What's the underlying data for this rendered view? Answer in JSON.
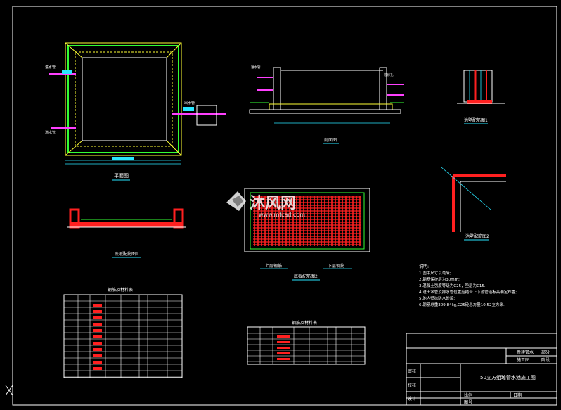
{
  "watermark": {
    "brand": "沐风网",
    "url": "www.mfcad.com"
  },
  "views": {
    "plan": "平面图",
    "section": "剖面图",
    "bottom_rebar_1": "底板配筋图1",
    "bottom_rebar_2": "底板配筋图2",
    "top_rebar": "上层钢筋",
    "bottom_rebar": "下层钢筋",
    "wall_rebar_1": "池壁配筋图1",
    "wall_rebar_2": "池壁配筋图2"
  },
  "pipes": {
    "inlet": "进水管",
    "outlet": "出水管",
    "overflow": "溢水管",
    "manhole": "检修孔"
  },
  "tables": {
    "table1_title": "钢筋及材料表",
    "table2_title": "钢筋及材料表"
  },
  "notes": {
    "header": "说明:",
    "items": [
      "1.图中尺寸以毫米;",
      "2.钢筋保护层为30mm;",
      "3.混凝土强度等级为C25，垫层为C15.",
      "4.进出水管及排水管位置应结合上下游管道标高确定布置;",
      "5.池内壁抹防水砂浆;",
      "6.钢筋总重309.84kg,C25砼总方量10.52立方米."
    ]
  },
  "title_block": {
    "project_label_1": "新建管水",
    "project_label_2": "部分",
    "stage_label_1": "施工图",
    "stage_label_2": "阶段",
    "review": "审核",
    "check": "校核",
    "design": "设计",
    "drawing_title": "50立方组琼管水池施工图",
    "drawing_no": "图号",
    "date": "日期",
    "scale": "比例"
  },
  "colors": {
    "background": "#000000",
    "outline": "#ffffff",
    "wall": "#33ff33",
    "fill": "#ffff00",
    "rebar": "#ff2020",
    "pipe": "#ff40ff",
    "dim": "#29e6ff"
  }
}
